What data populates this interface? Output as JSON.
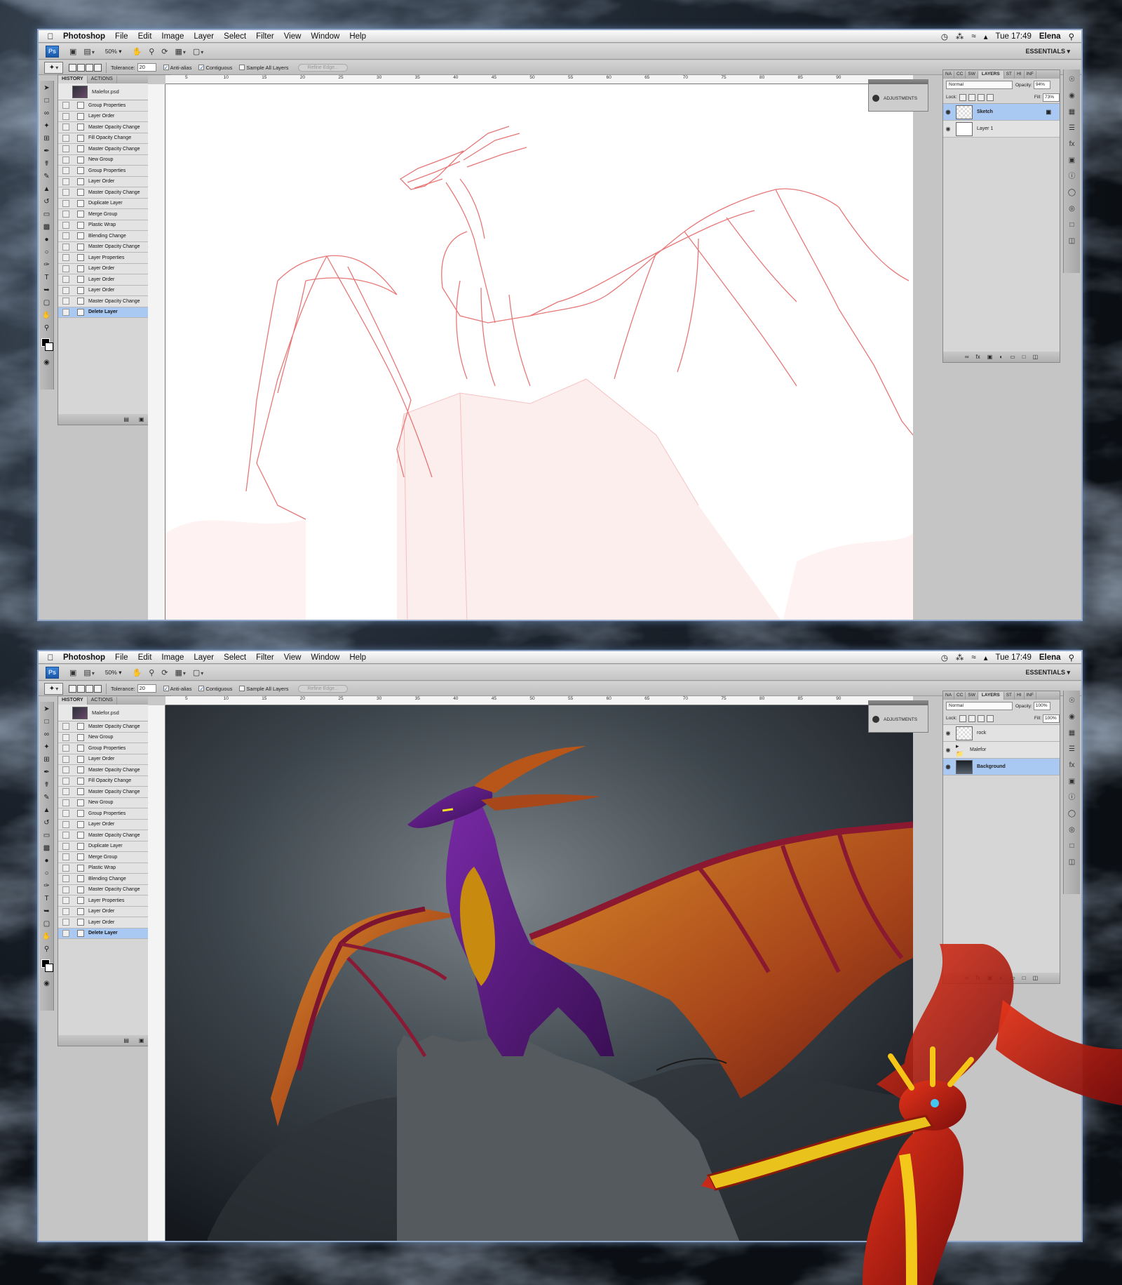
{
  "windows": [
    {
      "menu": {
        "app": "Photoshop",
        "items": [
          "File",
          "Edit",
          "Image",
          "Layer",
          "Select",
          "Filter",
          "View",
          "Window",
          "Help"
        ],
        "clock": "Tue 17:49",
        "user": "Elena"
      },
      "toolbar": {
        "ps_label": "Ps",
        "zoom": "50%",
        "essentials": "ESSENTIALS ▾"
      },
      "options": {
        "tolerance_label": "Tolerance:",
        "tolerance_value": "20",
        "anti_alias": "Anti-alias",
        "contiguous": "Contiguous",
        "sample_all": "Sample All Layers",
        "refine": "Refine Edge..."
      },
      "history": {
        "tab_history": "HISTORY",
        "tab_actions": "ACTIONS",
        "snapshot": "Malefor.psd",
        "items": [
          "Group Properties",
          "Layer Order",
          "Master Opacity Change",
          "Fill Opacity Change",
          "Master Opacity Change",
          "New Group",
          "Group Properties",
          "Layer Order",
          "Master Opacity Change",
          "Duplicate Layer",
          "Merge Group",
          "Plastic Wrap",
          "Blending Change",
          "Master Opacity Change",
          "Layer Properties",
          "Layer Order",
          "Layer Order",
          "Layer Order",
          "Master Opacity Change",
          "Delete Layer"
        ]
      },
      "adjustments": "ADJUSTMENTS",
      "layers": {
        "tabs": [
          "NA",
          "CC",
          "SW",
          "LAYERS",
          "ST",
          "HI",
          "INF"
        ],
        "blend": "Normal",
        "opacity_label": "Opacity:",
        "opacity": "94%",
        "lock_label": "Lock:",
        "fill_label": "Fill:",
        "fill": "73%",
        "items": [
          {
            "name": "Sketch",
            "selected": true
          },
          {
            "name": "Layer 1",
            "selected": false
          }
        ]
      }
    },
    {
      "menu": {
        "app": "Photoshop",
        "items": [
          "File",
          "Edit",
          "Image",
          "Layer",
          "Select",
          "Filter",
          "View",
          "Window",
          "Help"
        ],
        "clock": "Tue 17:49",
        "user": "Elena"
      },
      "toolbar": {
        "ps_label": "Ps",
        "zoom": "50%",
        "essentials": "ESSENTIALS ▾"
      },
      "options": {
        "tolerance_label": "Tolerance:",
        "tolerance_value": "20",
        "anti_alias": "Anti-alias",
        "contiguous": "Contiguous",
        "sample_all": "Sample All Layers",
        "refine": "Refine Edge..."
      },
      "history": {
        "tab_history": "HISTORY",
        "tab_actions": "ACTIONS",
        "snapshot": "Malefor.psd",
        "items": [
          "Master Opacity Change",
          "New Group",
          "Group Properties",
          "Layer Order",
          "Master Opacity Change",
          "Fill Opacity Change",
          "Master Opacity Change",
          "New Group",
          "Group Properties",
          "Layer Order",
          "Master Opacity Change",
          "Duplicate Layer",
          "Merge Group",
          "Plastic Wrap",
          "Blending Change",
          "Master Opacity Change",
          "Layer Properties",
          "Layer Order",
          "Layer Order",
          "Delete Layer"
        ]
      },
      "adjustments": "ADJUSTMENTS",
      "layers": {
        "tabs": [
          "NA",
          "CC",
          "SW",
          "LAYERS",
          "ST",
          "HI",
          "INF"
        ],
        "blend": "Normal",
        "opacity_label": "Opacity:",
        "opacity": "100%",
        "lock_label": "Lock:",
        "fill_label": "Fill:",
        "fill": "100%",
        "items": [
          {
            "name": "rock",
            "selected": false
          },
          {
            "name": "Malefor",
            "selected": false,
            "group": true
          },
          {
            "name": "Background",
            "selected": true
          }
        ]
      }
    }
  ],
  "ruler_labels": [
    "5",
    "10",
    "15",
    "20",
    "25",
    "30",
    "35",
    "40",
    "45",
    "50",
    "55",
    "60",
    "65",
    "70",
    "75",
    "80",
    "85",
    "90"
  ],
  "colors": {
    "accent_blue": "#a9c8f2",
    "ps_blue": "#1a57a8",
    "window_border": "#8fa6c8",
    "sketch_red": "#e04a4a",
    "dragon_purple": "#5b1a7a",
    "wing_red": "#8a1830",
    "belly_gold": "#c98a10"
  }
}
